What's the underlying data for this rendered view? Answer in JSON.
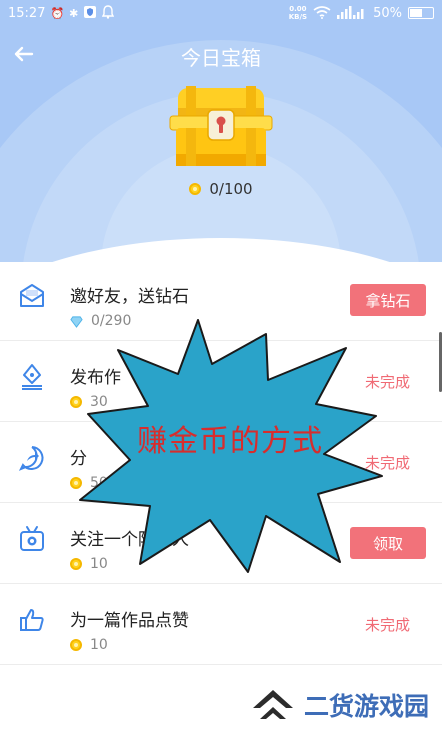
{
  "status_bar": {
    "time": "15:27",
    "net_speed_value": "0.00",
    "net_speed_unit": "KB/S",
    "battery_percent": "50%",
    "battery_level": 0.5
  },
  "header": {
    "title": "今日宝箱",
    "coins_progress": "0/100"
  },
  "tasks": [
    {
      "title": "邀好友，送钻石",
      "reward": "0/290",
      "reward_icon": "diamond-icon",
      "action": "拿钻石",
      "action_type": "button"
    },
    {
      "title": "发布作",
      "reward": "30",
      "reward_icon": "coin-icon",
      "action": "未完成",
      "action_type": "status"
    },
    {
      "title": "分",
      "reward": "50",
      "reward_icon": "coin-icon",
      "action": "未完成",
      "action_type": "status"
    },
    {
      "title": "关注一个陌生人",
      "reward": "10",
      "reward_icon": "coin-icon",
      "action": "领取",
      "action_type": "button"
    },
    {
      "title": "为一篇作品点赞",
      "reward": "10",
      "reward_icon": "coin-icon",
      "action": "未完成",
      "action_type": "status"
    }
  ],
  "overlay": {
    "text": "赚金币的方式",
    "fill_color": "#2aa3c9",
    "text_color": "#d72d2d"
  },
  "watermark": {
    "text": "二货游戏园"
  },
  "colors": {
    "header_bg": "#a8c8f6",
    "accent_red": "#f2727a",
    "icon_blue": "#3f86e8"
  }
}
